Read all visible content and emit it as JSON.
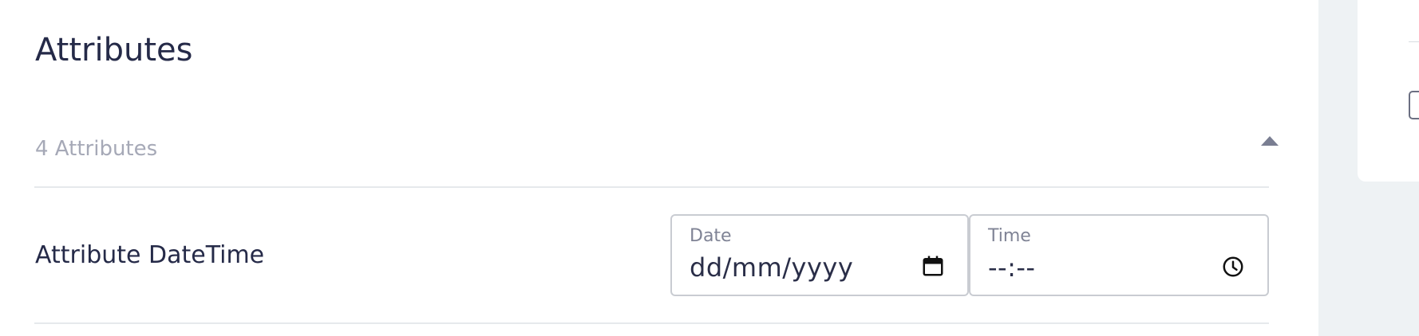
{
  "section": {
    "title": "Attributes"
  },
  "accordion": {
    "label": "4 Attributes",
    "icon": "chevron-up-icon"
  },
  "attribute_row": {
    "label": "Attribute DateTime",
    "date_field": {
      "caption": "Date",
      "value": "dd/mm/yyyy",
      "icon": "calendar-icon"
    },
    "time_field": {
      "caption": "Time",
      "value": "--:--",
      "icon": "clock-icon"
    }
  },
  "colors": {
    "text_primary": "#252a48",
    "text_muted": "#a6a9b7",
    "border": "#c9ccd2",
    "divider": "#e6e9ec",
    "side_panel": "#eef2f4"
  }
}
